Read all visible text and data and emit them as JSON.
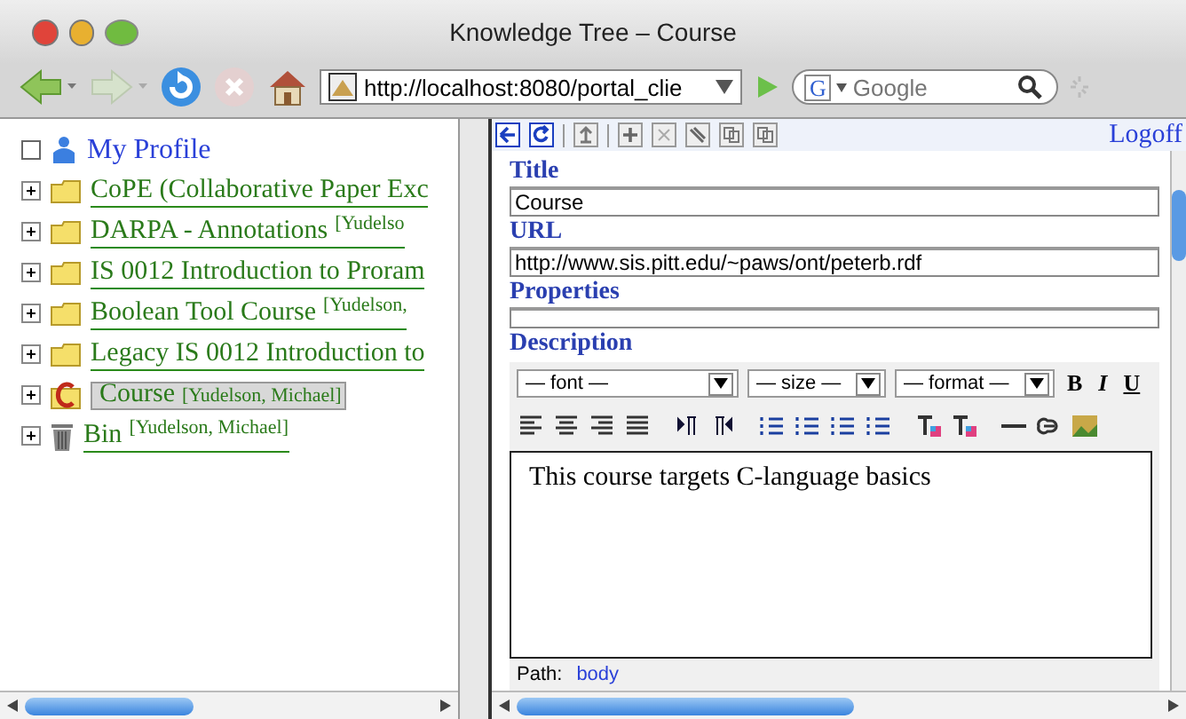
{
  "window": {
    "title": "Knowledge Tree – Course"
  },
  "navbar": {
    "address": "http://localhost:8080/portal_clie",
    "search_engine": "G",
    "search_placeholder": "Google"
  },
  "tree": [
    {
      "kind": "profile",
      "label": "My Profile",
      "checked": false,
      "selected": false
    },
    {
      "kind": "folder",
      "label": "CoPE (Collaborative Paper Exc",
      "selected": false
    },
    {
      "kind": "folder",
      "label": "DARPA - Annotations",
      "author": "[Yudelso",
      "selected": false
    },
    {
      "kind": "folder",
      "label": "IS 0012 Introduction to Proram",
      "selected": false
    },
    {
      "kind": "folder",
      "label": "Boolean Tool Course",
      "author": "[Yudelson,",
      "selected": false
    },
    {
      "kind": "folder",
      "label": "Legacy IS 0012 Introduction to",
      "selected": false
    },
    {
      "kind": "course",
      "label": "Course",
      "author": "[Yudelson, Michael]",
      "selected": true
    },
    {
      "kind": "bin",
      "label": "Bin",
      "author": "[Yudelson, Michael]",
      "selected": false
    }
  ],
  "editor": {
    "logoff": "Logoff",
    "fields": [
      {
        "label": "Title",
        "value": "Course"
      },
      {
        "label": "URL",
        "value": "http://www.sis.pitt.edu/~paws/ont/peterb.rdf"
      },
      {
        "label": "Properties"
      }
    ],
    "description_label": "Description",
    "selects": [
      "— font —",
      "— size —",
      "— format —"
    ],
    "style_buttons": [
      "B",
      "I",
      "U"
    ],
    "content": "This course targets C-language basics",
    "path_label": "Path:",
    "path_value": "body"
  }
}
